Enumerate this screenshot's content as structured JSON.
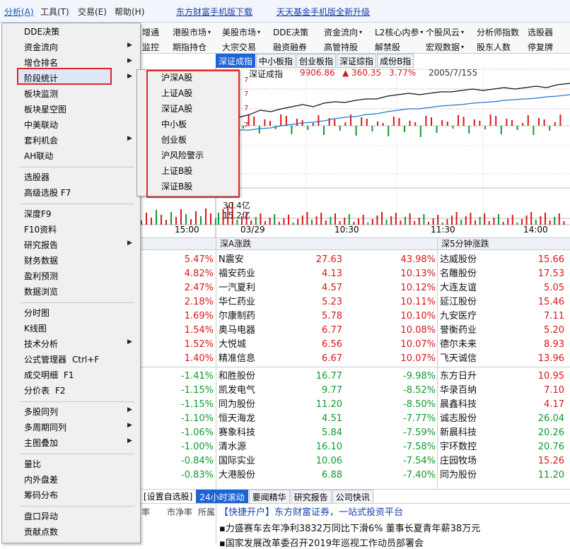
{
  "menubar": {
    "items": [
      "分析(A)",
      "工具(T)",
      "交易(E)",
      "帮助(H)"
    ],
    "links": [
      "东方财富手机版下载",
      "天天基金手机版全新升级"
    ]
  },
  "toolbar": {
    "row1": [
      "港股市场",
      "美股市场",
      "DDE决策",
      "资金流向",
      "L2核心内参",
      "个股风云",
      "分析师指数",
      "选股器"
    ],
    "row2": [
      "期指持仓",
      "大宗交易",
      "融资融券",
      "高管持股",
      "解禁股",
      "宏观数据",
      "股东人数",
      "停复牌"
    ],
    "left_row1": "增通",
    "left_row2": "监控"
  },
  "index_tabs": [
    "深证成指",
    "中小板指",
    "创业板指",
    "深证综指",
    "成份B指"
  ],
  "index_info": {
    "name": "深证成指",
    "value": "9906.86",
    "change": "▲ 360.35",
    "pct": "3.77%",
    "breadth": "2005/7/155"
  },
  "chart_labels": {
    "vol1": "30.4亿",
    "vol2": "15.2亿",
    "left_time": "15:00",
    "times": [
      "03/29",
      "10:30",
      "11:30",
      "14:00"
    ]
  },
  "col_headers": {
    "mid": "深A涨跌",
    "right": "深5分钟涨跌"
  },
  "left_pcts": [
    "5.47%",
    "4.82%",
    "2.47%",
    "2.18%",
    "1.69%",
    "1.54%",
    "1.52%",
    "1.40%",
    "-1.41%",
    "-1.15%",
    "-1.15%",
    "-1.10%",
    "-1.06%",
    "-1.00%",
    "-0.84%",
    "-0.83%"
  ],
  "mid_rows": [
    [
      "N震安",
      "27.63",
      "43.98%"
    ],
    [
      "福安药业",
      "4.13",
      "10.13%"
    ],
    [
      "一汽夏利",
      "4.57",
      "10.12%"
    ],
    [
      "华仁药业",
      "5.23",
      "10.11%"
    ],
    [
      "尔康制药",
      "5.78",
      "10.10%"
    ],
    [
      "奥马电器",
      "6.77",
      "10.08%"
    ],
    [
      "大悦城",
      "6.56",
      "10.07%"
    ],
    [
      "精准信息",
      "6.67",
      "10.07%"
    ],
    [
      "和胜股份",
      "16.77",
      "-9.98%"
    ],
    [
      "凯发电气",
      "9.77",
      "-8.52%"
    ],
    [
      "同为股份",
      "11.20",
      "-8.50%"
    ],
    [
      "恒天海龙",
      "4.51",
      "-7.77%"
    ],
    [
      "赛象科技",
      "5.84",
      "-7.59%"
    ],
    [
      "清水源",
      "16.10",
      "-7.58%"
    ],
    [
      "国际实业",
      "10.06",
      "-7.54%"
    ],
    [
      "大港股份",
      "6.88",
      "-7.40%"
    ]
  ],
  "right_rows": [
    [
      "达威股份",
      "15.66"
    ],
    [
      "名雕股份",
      "17.53"
    ],
    [
      "大连友谊",
      "5.05"
    ],
    [
      "延江股份",
      "15.46"
    ],
    [
      "九安医疗",
      "7.11"
    ],
    [
      "誉衡药业",
      "5.20"
    ],
    [
      "德尔未来",
      "8.93"
    ],
    [
      "飞天诚信",
      "13.96"
    ],
    [
      "东方日升",
      "10.95"
    ],
    [
      "华录百纳",
      "7.10"
    ],
    [
      "晨鑫科技",
      "4.17"
    ],
    [
      "诚志股份",
      "26.04"
    ],
    [
      "新晨科技",
      "20.26"
    ],
    [
      "宇环数控",
      "20.76"
    ],
    [
      "庄园牧场",
      "15.26"
    ],
    [
      "同为股份",
      "11.20"
    ]
  ],
  "news_tabs": [
    "[设置自选股]",
    "24小时滚动",
    "要闻精华",
    "研究报告",
    "公司快讯"
  ],
  "news_left_labels": [
    "率",
    "市净率",
    "所属"
  ],
  "news": [
    "【快捷开户】东方财富证券，一站式投资平台",
    "▪力盛赛车去年净利3832万同比下滑6% 董事长夏青年薪38万元",
    "▪国家发展改革委召开2019年巡视工作动员部署会"
  ],
  "menu": {
    "groups": [
      [
        {
          "label": "DDE决策"
        },
        {
          "label": "资金流向",
          "sub": true
        },
        {
          "label": "增仓排名",
          "sub": true
        },
        {
          "label": "阶段统计",
          "sub": true
        },
        {
          "label": "板块监测"
        },
        {
          "label": "板块星空图"
        },
        {
          "label": "中美联动"
        },
        {
          "label": "套利机会",
          "sub": true
        },
        {
          "label": "AH联动"
        }
      ],
      [
        {
          "label": "选股器"
        },
        {
          "label": "高级选股 F7"
        }
      ],
      [
        {
          "label": "深度F9"
        },
        {
          "label": "F10资料"
        },
        {
          "label": "研究报告",
          "sub": true
        },
        {
          "label": "财务数据"
        },
        {
          "label": "盈利预测"
        },
        {
          "label": "数据浏览"
        }
      ],
      [
        {
          "label": "分时图"
        },
        {
          "label": "K线图"
        },
        {
          "label": "技术分析",
          "sub": true
        },
        {
          "label": "公式管理器",
          "shortcut": "Ctrl+F"
        },
        {
          "label": "成交明细",
          "shortcut": "F1"
        },
        {
          "label": "分价表",
          "shortcut": "F2"
        }
      ],
      [
        {
          "label": "多股同列",
          "sub": true
        },
        {
          "label": "多周期同列",
          "sub": true
        },
        {
          "label": "主图叠加",
          "sub": true
        }
      ],
      [
        {
          "label": "量比"
        },
        {
          "label": "内外盘差"
        },
        {
          "label": "筹码分布"
        }
      ],
      [
        {
          "label": "盘口异动"
        },
        {
          "label": "贡献点数"
        }
      ]
    ]
  },
  "submenu": [
    "沪深A股",
    "上证A股",
    "深证A股",
    "中小板",
    "创业板",
    "沪风险警示",
    "上证B股",
    "深证B股"
  ],
  "colors": {
    "up": "#d8161b",
    "down": "#0f9a2e",
    "accent": "#1e64d4",
    "highlight_box": "#e0262a"
  }
}
